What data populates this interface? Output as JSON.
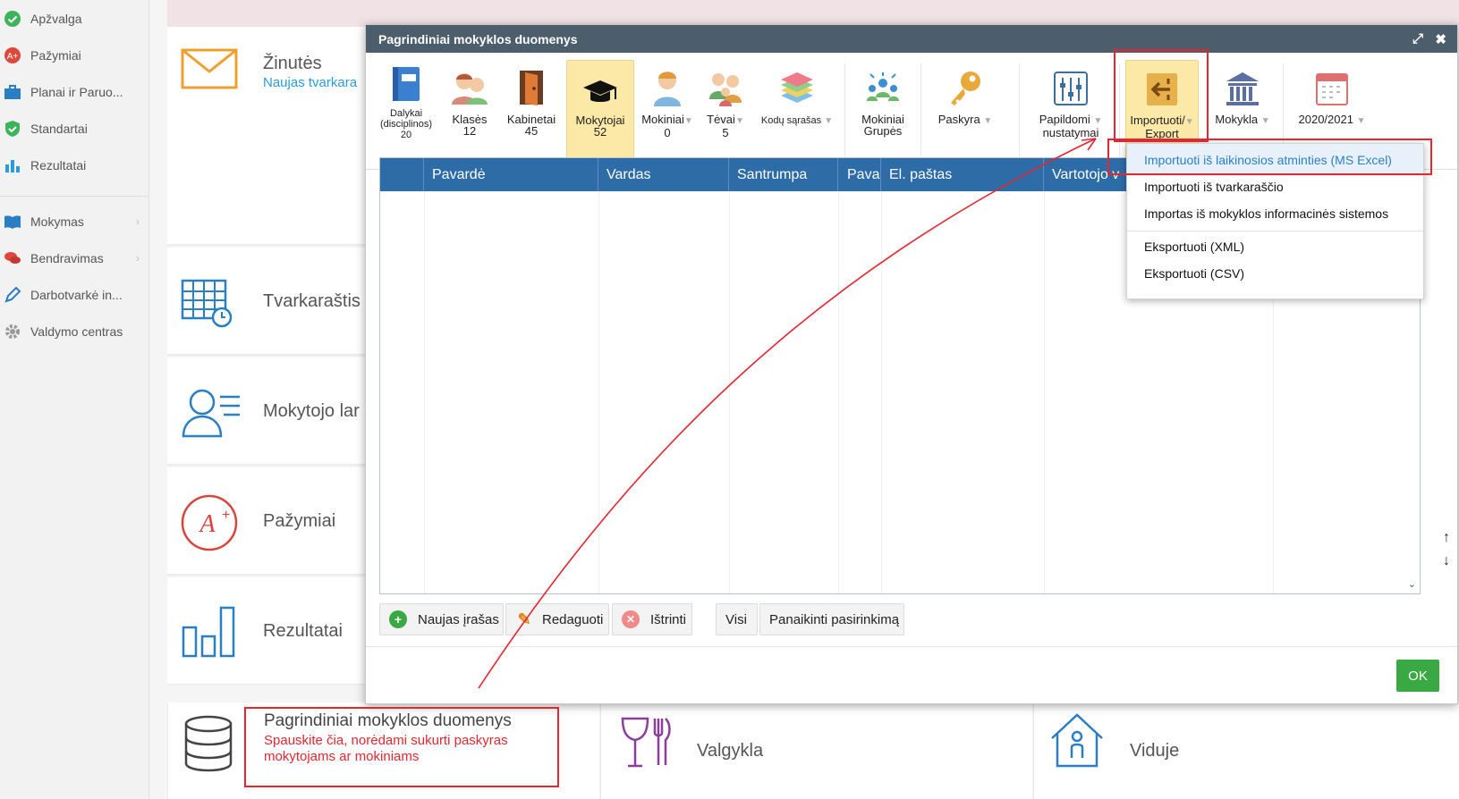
{
  "sidebar": {
    "items": [
      {
        "label": "Apžvalga",
        "icon": "check-circle-icon"
      },
      {
        "label": "Pažymiai",
        "icon": "grade-icon"
      },
      {
        "label": "Planai ir Paruo...",
        "icon": "briefcase-icon"
      },
      {
        "label": "Standartai",
        "icon": "shield-check-icon"
      },
      {
        "label": "Rezultatai",
        "icon": "bar-chart-icon"
      },
      {
        "label": "Mokymas",
        "icon": "book-icon"
      },
      {
        "label": "Bendravimas",
        "icon": "chat-icon"
      },
      {
        "label": "Darbotvarkė in...",
        "icon": "pencil-icon"
      },
      {
        "label": "Valdymo centras",
        "icon": "gear-icon"
      }
    ]
  },
  "tiles": {
    "messages_label": "Žinutės",
    "messages_sub": "Naujas tvarkara",
    "schedule_label": "Tvarkaraštis",
    "teacher_label": "Mokytojo lar",
    "grades_label": "Pažymiai",
    "results_label": "Rezultatai",
    "school_data_label": "Pagrindiniai mokyklos duomenys",
    "school_data_sub1": "Spauskite čia, norėdami sukurti paskyras",
    "school_data_sub2": "mokytojams ar mokiniams",
    "canteen_label": "Valgykla",
    "inside_label": "Viduje"
  },
  "dialog": {
    "title": "Pagrindiniai mokyklos duomenys",
    "toolbar": [
      {
        "label": "Dalykai",
        "label2": "(disciplinos)",
        "count": "20",
        "icon": "book-icon"
      },
      {
        "label": "Klasės",
        "count": "12",
        "icon": "students-icon"
      },
      {
        "label": "Kabinetai",
        "count": "45",
        "icon": "door-icon"
      },
      {
        "label": "Mokytojai",
        "count": "52",
        "icon": "graduation-cap-icon"
      },
      {
        "label": "Mokiniai",
        "count": "0",
        "icon": "student-icon"
      },
      {
        "label": "Tėvai",
        "count": "5",
        "icon": "parents-icon"
      },
      {
        "label": "Kodų sąrašas",
        "count": "",
        "icon": "layers-icon"
      },
      {
        "label": "Mokiniai",
        "label2": "Grupės",
        "icon": "group-icon"
      },
      {
        "label": "Paskyra",
        "icon": "key-icon"
      },
      {
        "label": "Papildomi",
        "label2": "nustatymai",
        "icon": "sliders-icon"
      },
      {
        "label": "Importuoti/",
        "label2": "Export",
        "icon": "import-icon"
      },
      {
        "label": "Mokykla",
        "icon": "building-icon"
      },
      {
        "label": "2020/2021",
        "icon": "calendar-icon"
      }
    ],
    "grid_columns": [
      "",
      "Pavardė",
      "Vardas",
      "Santrumpa",
      "Pava",
      "El. paštas",
      "Vartotojo v"
    ],
    "buttons": {
      "new": "Naujas įrašas",
      "edit": "Redaguoti",
      "delete": "Ištrinti",
      "all": "Visi",
      "clear": "Panaikinti pasirinkimą",
      "ok": "OK"
    },
    "scroll_up": "↑",
    "scroll_down": "↓"
  },
  "menu": {
    "items": [
      "Importuoti iš laikinosios atminties (MS Excel)",
      "Importuoti iš tvarkaraščio",
      "Importas iš mokyklos informacinės sistemos",
      "Eksportuoti (XML)",
      "Eksportuoti (CSV)"
    ]
  },
  "colors": {
    "dialog_title_bg": "#4c5d6c",
    "grid_header_bg": "#2d6ca6",
    "ok_green": "#3aa843",
    "annotation_red": "#e3262f",
    "selected_yellow": "#fce9a8"
  }
}
